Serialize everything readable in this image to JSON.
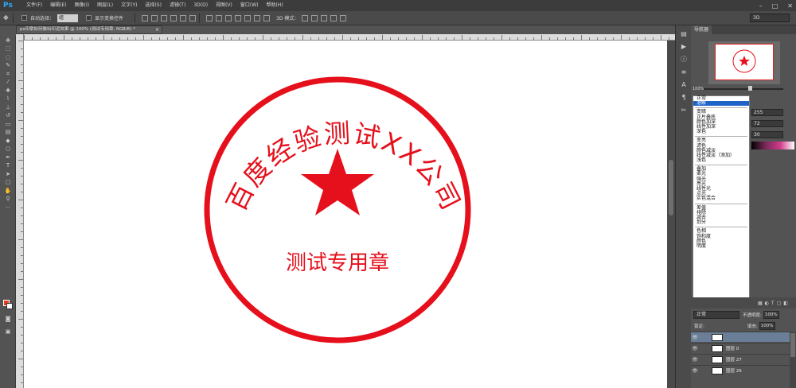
{
  "app": {
    "logo": "Ps"
  },
  "menu": [
    "文件(F)",
    "编辑(E)",
    "图像(I)",
    "图层(L)",
    "文字(Y)",
    "选择(S)",
    "滤镜(T)",
    "3D(D)",
    "视图(V)",
    "窗口(W)",
    "帮助(H)"
  ],
  "options": {
    "auto_select_label": "自动选择：",
    "auto_select_value": "组",
    "show_transform_label": "显示变换控件",
    "mode_3d_label": "3D 模式：",
    "workspace_value": "3D"
  },
  "document": {
    "tab_title": "ps印章如何做出印泥效果 @ 100% (测试专用章, RGB/8) *",
    "seal_arc_text": "百度经验测试XX公司",
    "seal_bottom_text": "测试专用章",
    "seal_color": "#e5101b"
  },
  "panels": {
    "navigator_tab": "导航器",
    "zoom": "100%",
    "color_values": [
      "255",
      "72",
      "30"
    ]
  },
  "blend_groups": [
    [
      "正常",
      "溶解"
    ],
    [
      "变暗",
      "正片叠底",
      "颜色加深",
      "线性加深",
      "深色"
    ],
    [
      "变亮",
      "滤色",
      "颜色减淡",
      "线性减淡（添加）",
      "浅色"
    ],
    [
      "叠加",
      "柔光",
      "强光",
      "亮光",
      "线性光",
      "点光",
      "实色混合"
    ],
    [
      "差值",
      "排除",
      "减去",
      "划分"
    ],
    [
      "色相",
      "饱和度",
      "颜色",
      "明度"
    ]
  ],
  "blend_selected": "溶解",
  "layers": {
    "blend_mode": "正常",
    "opacity_label": "不透明度:",
    "opacity_value": "100%",
    "lock_label": "锁定:",
    "fill_label": "填充:",
    "fill_value": "100%",
    "rows": [
      "",
      "图层 0",
      "图层 27",
      "图层 26"
    ]
  }
}
